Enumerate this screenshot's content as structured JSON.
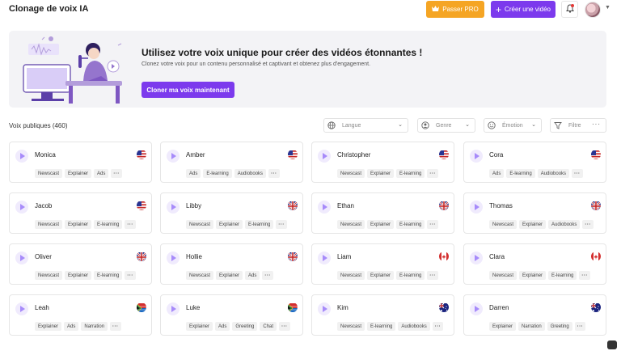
{
  "header": {
    "title": "Clonage de voix IA",
    "pro_label": "Passer PRO",
    "create_label": "Créer une vidéo"
  },
  "banner": {
    "title": "Utilisez votre voix unique pour créer des vidéos étonnantes !",
    "subtitle": "Clonez votre voix pour un contenu personnalisé et captivant et obtenez plus d'engagement.",
    "button": "Cloner ma voix maintenant"
  },
  "voices_section": {
    "title": "Voix publiques (460)",
    "filters": {
      "language": "Langue",
      "gender": "Genre",
      "emotion": "Émotion",
      "filter": "Filtre"
    }
  },
  "voices": [
    {
      "name": "Monica",
      "flag": "us",
      "tags": [
        "Newscast",
        "Explainer",
        "Ads"
      ]
    },
    {
      "name": "Amber",
      "flag": "us",
      "tags": [
        "Ads",
        "E-learning",
        "Audiobooks"
      ]
    },
    {
      "name": "Christopher",
      "flag": "us",
      "tags": [
        "Newscast",
        "Explainer",
        "E-learning"
      ]
    },
    {
      "name": "Cora",
      "flag": "us",
      "tags": [
        "Ads",
        "E-learning",
        "Audiobooks"
      ]
    },
    {
      "name": "Jacob",
      "flag": "us",
      "tags": [
        "Newscast",
        "Explainer",
        "E-learning"
      ]
    },
    {
      "name": "Libby",
      "flag": "uk",
      "tags": [
        "Newscast",
        "Explainer",
        "E-learning"
      ]
    },
    {
      "name": "Ethan",
      "flag": "uk",
      "tags": [
        "Newscast",
        "Explainer",
        "E-learning"
      ]
    },
    {
      "name": "Thomas",
      "flag": "uk",
      "tags": [
        "Newscast",
        "Explainer",
        "Audiobooks"
      ]
    },
    {
      "name": "Oliver",
      "flag": "uk",
      "tags": [
        "Newscast",
        "Explainer",
        "E-learning"
      ]
    },
    {
      "name": "Hollie",
      "flag": "uk",
      "tags": [
        "Newscast",
        "Explainer",
        "Ads"
      ]
    },
    {
      "name": "Liam",
      "flag": "ca",
      "tags": [
        "Newscast",
        "Explainer",
        "E-learning"
      ]
    },
    {
      "name": "Clara",
      "flag": "ca",
      "tags": [
        "Newscast",
        "Explainer",
        "E-learning"
      ]
    },
    {
      "name": "Leah",
      "flag": "za",
      "tags": [
        "Explainer",
        "Ads",
        "Narration"
      ]
    },
    {
      "name": "Luke",
      "flag": "za",
      "tags": [
        "Explainer",
        "Ads",
        "Greeting",
        "Chat"
      ]
    },
    {
      "name": "Kim",
      "flag": "au",
      "tags": [
        "Newscast",
        "E-learning",
        "Audiobooks"
      ]
    },
    {
      "name": "Darren",
      "flag": "au",
      "tags": [
        "Explainer",
        "Narration",
        "Greeting"
      ]
    }
  ],
  "more_label": "···",
  "colors": {
    "accent": "#7c3aed",
    "pro": "#f5a524"
  }
}
